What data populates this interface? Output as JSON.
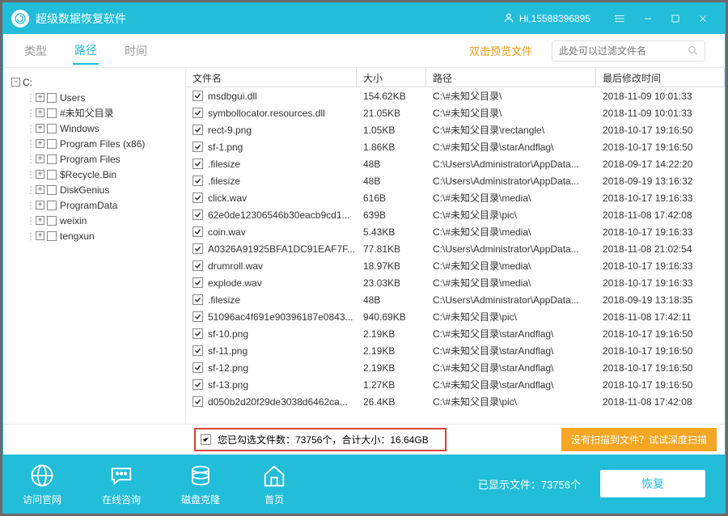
{
  "title": "超级数据恢复软件",
  "hi_prefix": "Hi,",
  "hi_user": "15588396895",
  "tabs": {
    "type": "类型",
    "path": "路径",
    "time": "时间"
  },
  "preview_hint": "双击预览文件",
  "search_placeholder": "此处可以过滤文件名",
  "tree": [
    {
      "level": 0,
      "exp": "-",
      "cb": false,
      "label": "C:"
    },
    {
      "level": 1,
      "exp": "+",
      "cb": true,
      "label": "Users"
    },
    {
      "level": 1,
      "exp": "+",
      "cb": true,
      "label": "#未知父目录"
    },
    {
      "level": 1,
      "exp": "+",
      "cb": true,
      "label": "Windows"
    },
    {
      "level": 1,
      "exp": "+",
      "cb": true,
      "label": "Program Files (x86)"
    },
    {
      "level": 1,
      "exp": "+",
      "cb": true,
      "label": "Program Files"
    },
    {
      "level": 1,
      "exp": "+",
      "cb": true,
      "label": "$Recycle.Bin"
    },
    {
      "level": 1,
      "exp": "+",
      "cb": true,
      "label": "DiskGenius"
    },
    {
      "level": 1,
      "exp": "+",
      "cb": true,
      "label": "ProgramData"
    },
    {
      "level": 1,
      "exp": "+",
      "cb": true,
      "label": "weixin"
    },
    {
      "level": 1,
      "exp": "+",
      "cb": true,
      "label": "tengxun"
    }
  ],
  "columns": {
    "name": "文件名",
    "size": "大小",
    "path": "路径",
    "date": "最后修改时间"
  },
  "files": [
    {
      "name": "msdbgui.dll",
      "size": "154.62KB",
      "path": "C:\\#未知父目录\\",
      "date": "2018-11-09 10:01:33"
    },
    {
      "name": "symbollocator.resources.dll",
      "size": "21.05KB",
      "path": "C:\\#未知父目录\\",
      "date": "2018-11-09 10:01:33"
    },
    {
      "name": "rect-9.png",
      "size": "1.05KB",
      "path": "C:\\#未知父目录\\rectangle\\",
      "date": "2018-10-17 19:16:50"
    },
    {
      "name": "sf-1.png",
      "size": "1.86KB",
      "path": "C:\\#未知父目录\\starAndflag\\",
      "date": "2018-10-17 19:16:50"
    },
    {
      "name": ".filesize",
      "size": "48B",
      "path": "C:\\Users\\Administrator\\AppData...",
      "date": "2018-09-17 14:22:20"
    },
    {
      "name": ".filesize",
      "size": "48B",
      "path": "C:\\Users\\Administrator\\AppData...",
      "date": "2018-09-19 13:16:32"
    },
    {
      "name": "click.wav",
      "size": "616B",
      "path": "C:\\#未知父目录\\media\\",
      "date": "2018-10-17 19:16:33"
    },
    {
      "name": "62e0de12306546b30eacb9cd1...",
      "size": "639B",
      "path": "C:\\#未知父目录\\pic\\",
      "date": "2018-11-08 17:42:08"
    },
    {
      "name": "coin.wav",
      "size": "5.43KB",
      "path": "C:\\#未知父目录\\media\\",
      "date": "2018-10-17 19:16:33"
    },
    {
      "name": "A0326A91925BFA1DC91EAF7F...",
      "size": "77.81KB",
      "path": "C:\\Users\\Administrator\\AppData...",
      "date": "2018-11-08 21:02:54"
    },
    {
      "name": "drumroll.wav",
      "size": "18.97KB",
      "path": "C:\\#未知父目录\\media\\",
      "date": "2018-10-17 19:16:33"
    },
    {
      "name": "explode.wav",
      "size": "23.03KB",
      "path": "C:\\#未知父目录\\media\\",
      "date": "2018-10-17 19:16:33"
    },
    {
      "name": ".filesize",
      "size": "48B",
      "path": "C:\\Users\\Administrator\\AppData...",
      "date": "2018-09-19 13:18:35"
    },
    {
      "name": "51096ac4f691e90396187e0843...",
      "size": "940.69KB",
      "path": "C:\\#未知父目录\\pic\\",
      "date": "2018-11-08 17:42:11"
    },
    {
      "name": "sf-10.png",
      "size": "2.19KB",
      "path": "C:\\#未知父目录\\starAndflag\\",
      "date": "2018-10-17 19:16:50"
    },
    {
      "name": "sf-11.png",
      "size": "2.19KB",
      "path": "C:\\#未知父目录\\starAndflag\\",
      "date": "2018-10-17 19:16:50"
    },
    {
      "name": "sf-12.png",
      "size": "2.19KB",
      "path": "C:\\#未知父目录\\starAndflag\\",
      "date": "2018-10-17 19:16:50"
    },
    {
      "name": "sf-13.png",
      "size": "1.27KB",
      "path": "C:\\#未知父目录\\starAndflag\\",
      "date": "2018-10-17 19:16:50"
    },
    {
      "name": "d050b2d20f29de3038d6462ca...",
      "size": "26.4KB",
      "path": "C:\\#未知父目录\\pic\\",
      "date": "2018-11-08 17:42:08"
    }
  ],
  "summary_text": "您已勾选文件数：73756个，合计大小：16.64GB",
  "scan_hint": "没有扫描到文件？试试深度扫描",
  "footer_btns": {
    "site": "访问官网",
    "chat": "在线咨询",
    "clone": "磁盘克隆",
    "home": "首页"
  },
  "status_text": "已显示文件：73756个",
  "recover_label": "恢复"
}
